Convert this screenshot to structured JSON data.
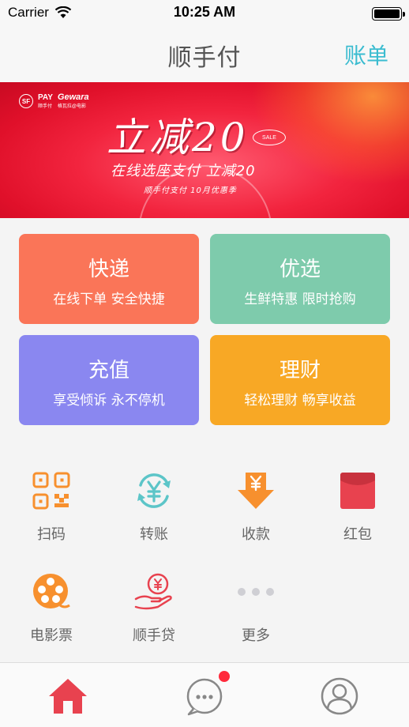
{
  "status_bar": {
    "carrier": "Carrier",
    "time": "10:25 AM"
  },
  "nav": {
    "title": "顺手付",
    "bill_label": "账单"
  },
  "banner": {
    "logo_pay": "PAY",
    "logo_pay_sub": "顺手付",
    "logo_gewara": "Gewara",
    "logo_gewara_sub": "格瓦拉@电影",
    "headline": "立减20",
    "sale_badge": "SALE",
    "subline": "在线选座支付 立减20",
    "subline2": "顺手付支付 10月优惠季"
  },
  "tiles": [
    {
      "title": "快递",
      "subtitle": "在线下单 安全快捷",
      "color": "#fa7558"
    },
    {
      "title": "优选",
      "subtitle": "生鲜特惠 限时抢购",
      "color": "#7ecbac"
    },
    {
      "title": "充值",
      "subtitle": "享受倾诉 永不停机",
      "color": "#8a87f0"
    },
    {
      "title": "理财",
      "subtitle": "轻松理财 畅享收益",
      "color": "#f8a825"
    }
  ],
  "grid": [
    {
      "label": "扫码",
      "icon": "qr-scan-icon"
    },
    {
      "label": "转账",
      "icon": "transfer-yuan-icon"
    },
    {
      "label": "收款",
      "icon": "receive-money-icon"
    },
    {
      "label": "红包",
      "icon": "red-envelope-icon"
    },
    {
      "label": "电影票",
      "icon": "film-reel-icon"
    },
    {
      "label": "顺手贷",
      "icon": "loan-hand-icon"
    },
    {
      "label": "更多",
      "icon": "more-dots-icon"
    }
  ],
  "colors": {
    "accent_teal": "#3bbcd0",
    "orange": "#f7902e",
    "red": "#e8424f",
    "teal": "#5cc5c8"
  },
  "tab_bar": [
    {
      "icon": "home-icon",
      "active": true
    },
    {
      "icon": "chat-bubble-icon",
      "has_badge": true
    },
    {
      "icon": "profile-icon"
    }
  ]
}
